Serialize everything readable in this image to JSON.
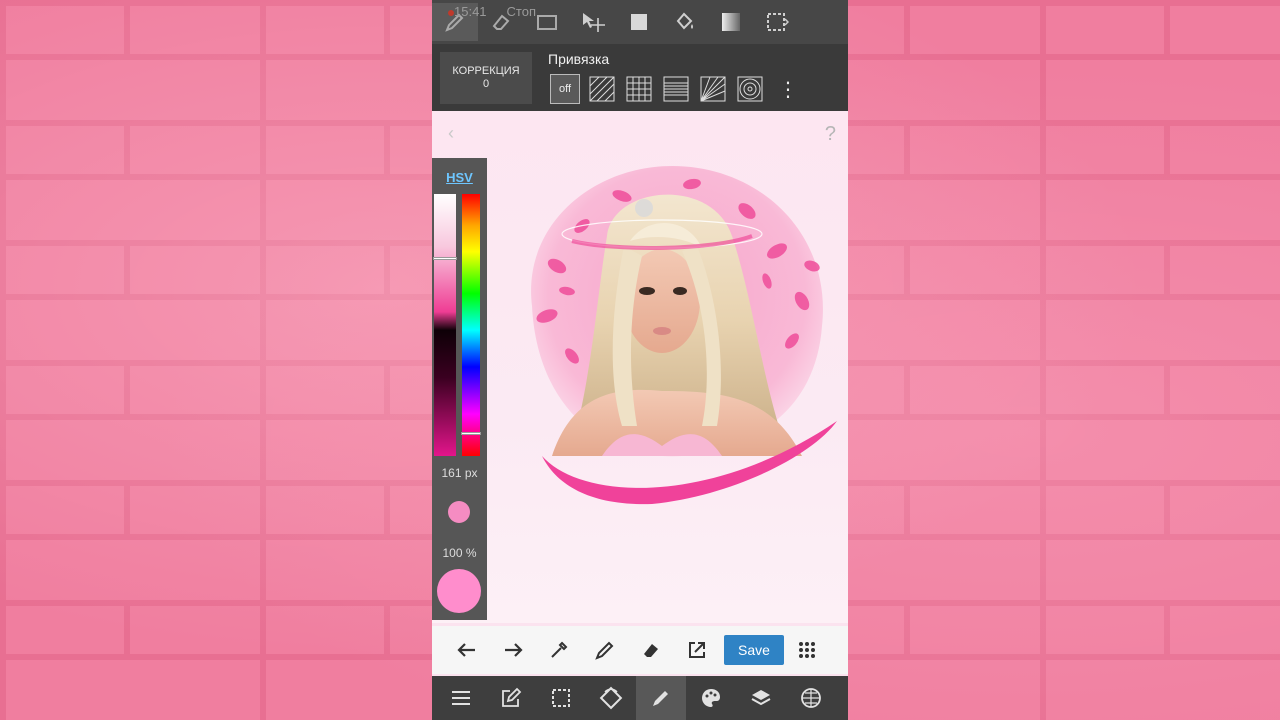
{
  "status": {
    "time": "15:41",
    "stop_label": "Стоп"
  },
  "top_tools": [
    {
      "icon": "pen-icon"
    },
    {
      "icon": "eraser-icon"
    },
    {
      "icon": "canvas-icon"
    },
    {
      "icon": "move-icon"
    },
    {
      "icon": "fill-rect-icon"
    },
    {
      "icon": "bucket-icon"
    },
    {
      "icon": "gradient-icon"
    },
    {
      "icon": "select-icon"
    }
  ],
  "correction": {
    "label": "КОРРЕКЦИЯ",
    "value": "0"
  },
  "snap": {
    "label": "Привязка",
    "off_label": "off"
  },
  "color_panel": {
    "mode": "HSV",
    "brush_size": "161 px",
    "opacity": "100 %",
    "brush_color": "#f58cc2",
    "main_color": "#ff8dcc"
  },
  "actions": {
    "save_label": "Save"
  },
  "colors": {
    "toolbar": "#474747",
    "accent": "#2f83c5",
    "wall": "#f07e9f"
  }
}
